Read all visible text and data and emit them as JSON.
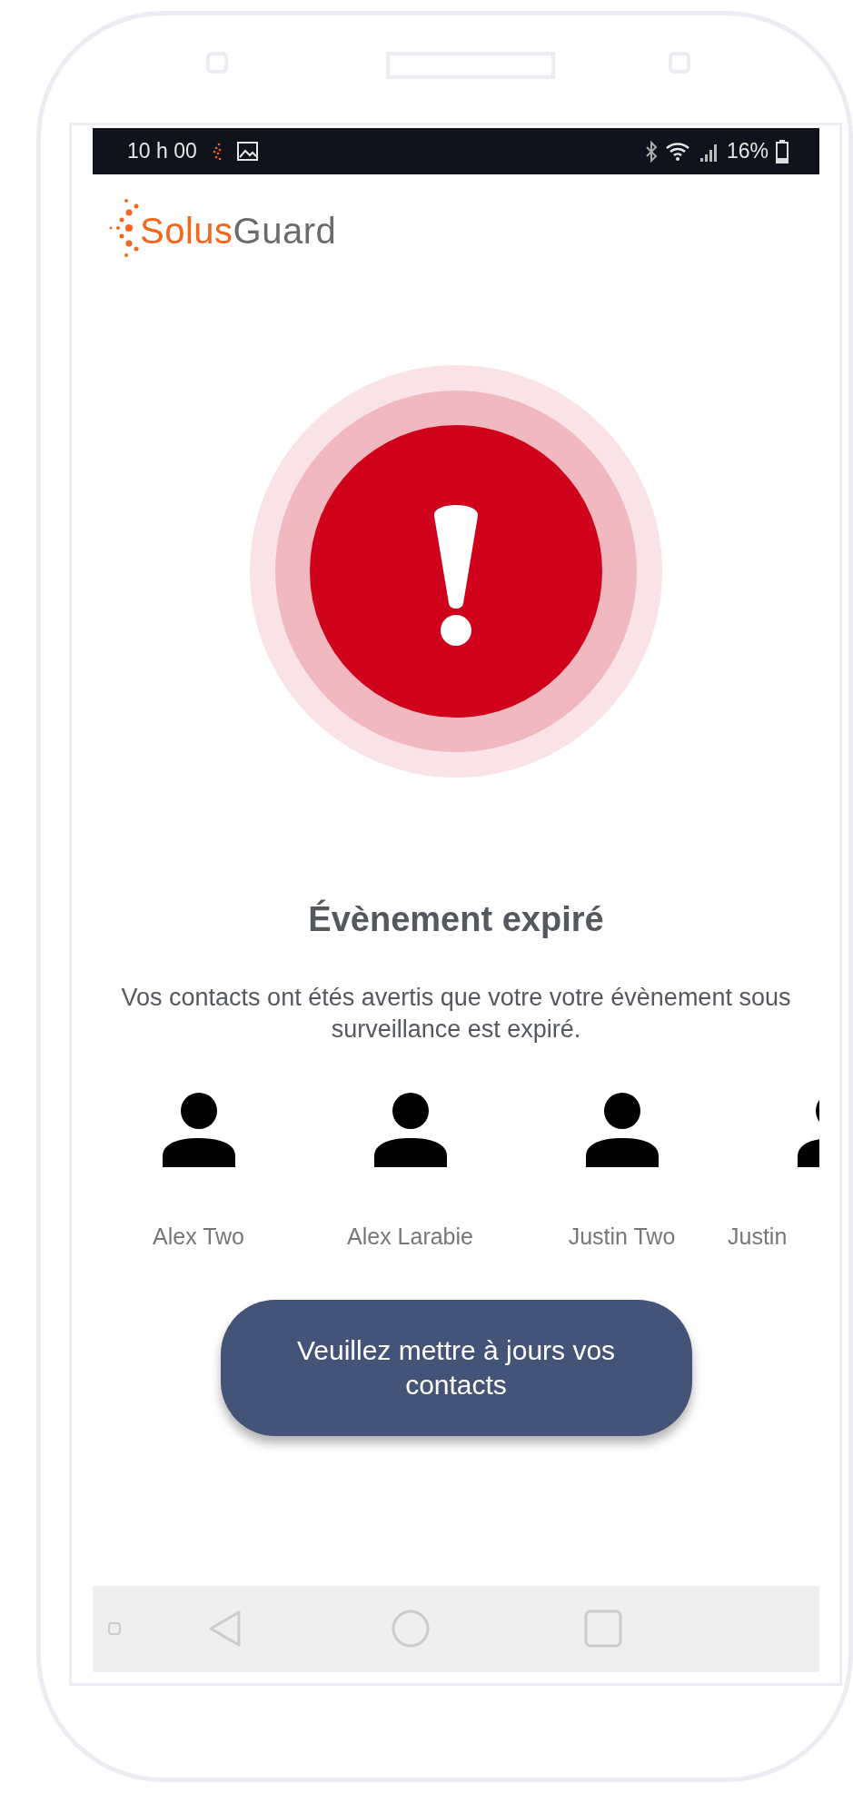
{
  "status_bar": {
    "time": "10 h 00",
    "battery": "16%"
  },
  "logo": {
    "part_1": "Solus",
    "part_2": "Guard"
  },
  "alert": {
    "title": "Évènement expiré",
    "message": "Vos contacts ont étés avertis que votre votre évènement sous surveillance est expiré."
  },
  "contacts": [
    {
      "name": "Alex Two"
    },
    {
      "name": "Alex Larabie"
    },
    {
      "name": "Justin Two"
    },
    {
      "name": "Justin"
    }
  ],
  "button": {
    "label": "Veuillez mettre à jours vos contacts"
  }
}
